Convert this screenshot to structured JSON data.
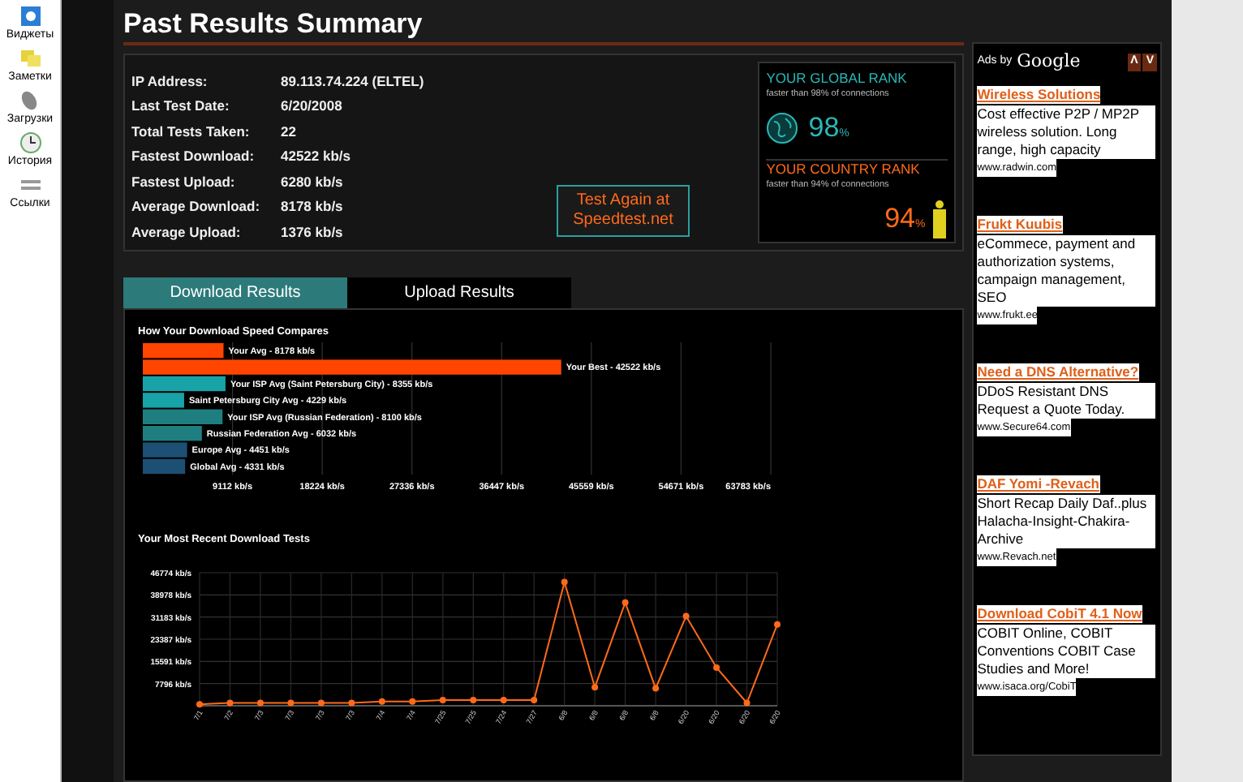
{
  "sidebar": {
    "items": [
      {
        "label": "Виджеты"
      },
      {
        "label": "Заметки"
      },
      {
        "label": "Загрузки"
      },
      {
        "label": "История"
      },
      {
        "label": "Ссылки"
      }
    ]
  },
  "title": "Past Results Summary",
  "summary": [
    {
      "label": "IP Address:",
      "value": "89.113.74.224 (ELTEL)"
    },
    {
      "label": "Last Test Date:",
      "value": "6/20/2008"
    },
    {
      "label": "Total Tests Taken:",
      "value": "22"
    },
    {
      "label": "Fastest Download:",
      "value": "42522 kb/s"
    },
    {
      "label": "Fastest Upload:",
      "value": "6280 kb/s"
    },
    {
      "label": "Average Download:",
      "value": "8178 kb/s"
    },
    {
      "label": "Average Upload:",
      "value": "1376 kb/s"
    }
  ],
  "test_again_button": "Test Again at Speedtest.net",
  "ranks": [
    {
      "kind": "global",
      "title": "YOUR GLOBAL RANK",
      "subtitle": "faster than 98% of connections",
      "value": "98",
      "unit": "%"
    },
    {
      "kind": "country",
      "title": "YOUR COUNTRY RANK",
      "subtitle": "faster than 94% of connections",
      "value": "94",
      "unit": "%"
    }
  ],
  "tabs": [
    {
      "label": "Download Results",
      "selected": true
    },
    {
      "label": "Upload Results",
      "selected": false
    }
  ],
  "bar_chart": {
    "chart_data": {
      "type": "bar",
      "orientation": "horizontal",
      "title": "How Your Download Speed Compares",
      "categories": [
        "Your Avg - 8178 kb/s",
        "Your Best - 42522 kb/s",
        "Your ISP Avg (Saint Petersburg City) - 8355 kb/s",
        "Saint Petersburg City Avg - 4229 kb/s",
        "Your ISP Avg (Russian Federation) - 8100 kb/s",
        "Russian Federation Avg - 6032 kb/s",
        "Europe Avg - 4451 kb/s",
        "Global Avg - 4331 kb/s"
      ],
      "values": [
        8200,
        42500,
        8400,
        4200,
        8100,
        6000,
        4500,
        4300
      ],
      "colors": [
        "#ff4500",
        "#ff4500",
        "#17a3a8",
        "#17a3a8",
        "#1f7f80",
        "#1f7f80",
        "#1c4f73",
        "#1c4f73"
      ],
      "xlim": [
        0,
        63783
      ],
      "grid": true,
      "xticks": [
        {
          "value": 9112,
          "label": "9112 kb/s"
        },
        {
          "value": 18224,
          "label": "18224 kb/s"
        },
        {
          "value": 27336,
          "label": "27336 kb/s"
        },
        {
          "value": 36447,
          "label": "36447 kb/s"
        },
        {
          "value": 45559,
          "label": "45559 kb/s"
        },
        {
          "value": 54671,
          "label": "54671 kb/s"
        },
        {
          "value": 63783,
          "label": "63783 kb/s"
        }
      ]
    }
  },
  "line_chart": {
    "chart_data": {
      "type": "line",
      "title": "Your Most Recent Download Tests",
      "categories": [
        "7/1",
        "7/2",
        "7/3",
        "7/3",
        "7/3",
        "7/3",
        "7/4",
        "7/4",
        "7/25",
        "7/25",
        "7/24",
        "7/27",
        "6/8",
        "6/8",
        "6/8",
        "6/8",
        "6/20",
        "6/20",
        "6/20",
        "6/20"
      ],
      "grid": true,
      "series": [
        {
          "color": "#ff6a1a",
          "marker": true,
          "values": [
            500,
            1000,
            1000,
            1000,
            1000,
            1000,
            1500,
            1500,
            2000,
            2000,
            2000,
            2000,
            43500,
            6500,
            36300,
            6100,
            31500,
            13400,
            1000,
            28600
          ]
        }
      ],
      "ylim": [
        0,
        46774
      ],
      "yticks": [
        {
          "value": 7796,
          "label": "7796 kb/s"
        },
        {
          "value": 15591,
          "label": "15591 kb/s"
        },
        {
          "value": 23387,
          "label": "23387 kb/s"
        },
        {
          "value": 31183,
          "label": "31183 kb/s"
        },
        {
          "value": 38978,
          "label": "38978 kb/s"
        },
        {
          "value": 46774,
          "label": "46774 kb/s"
        }
      ]
    }
  },
  "ads": {
    "header": "Ads by",
    "brand": "Google",
    "nav": [
      "Λ",
      "V"
    ],
    "items": [
      {
        "title": "Wireless Solutions",
        "text": "Cost effective P2P / MP2P wireless solution. Long range, high capacity",
        "url": "www.radwin.com"
      },
      {
        "title": "Frukt Kuubis",
        "text": "eCommece, payment and authorization systems, campaign management, SEO",
        "url": "www.frukt.ee"
      },
      {
        "title": "Need a DNS Alternative?",
        "text": "DDoS Resistant DNS Request a Quote Today.",
        "url": "www.Secure64.com"
      },
      {
        "title": "DAF Yomi -Revach",
        "text": "Short Recap Daily Daf..plus Halacha-Insight-Chakira-Archive",
        "url": "www.Revach.net"
      },
      {
        "title": "Download CobiT 4.1 Now",
        "text": "COBIT Online, COBIT Conventions COBIT Case Studies and More!",
        "url": "www.isaca.org/CobiT"
      }
    ]
  }
}
